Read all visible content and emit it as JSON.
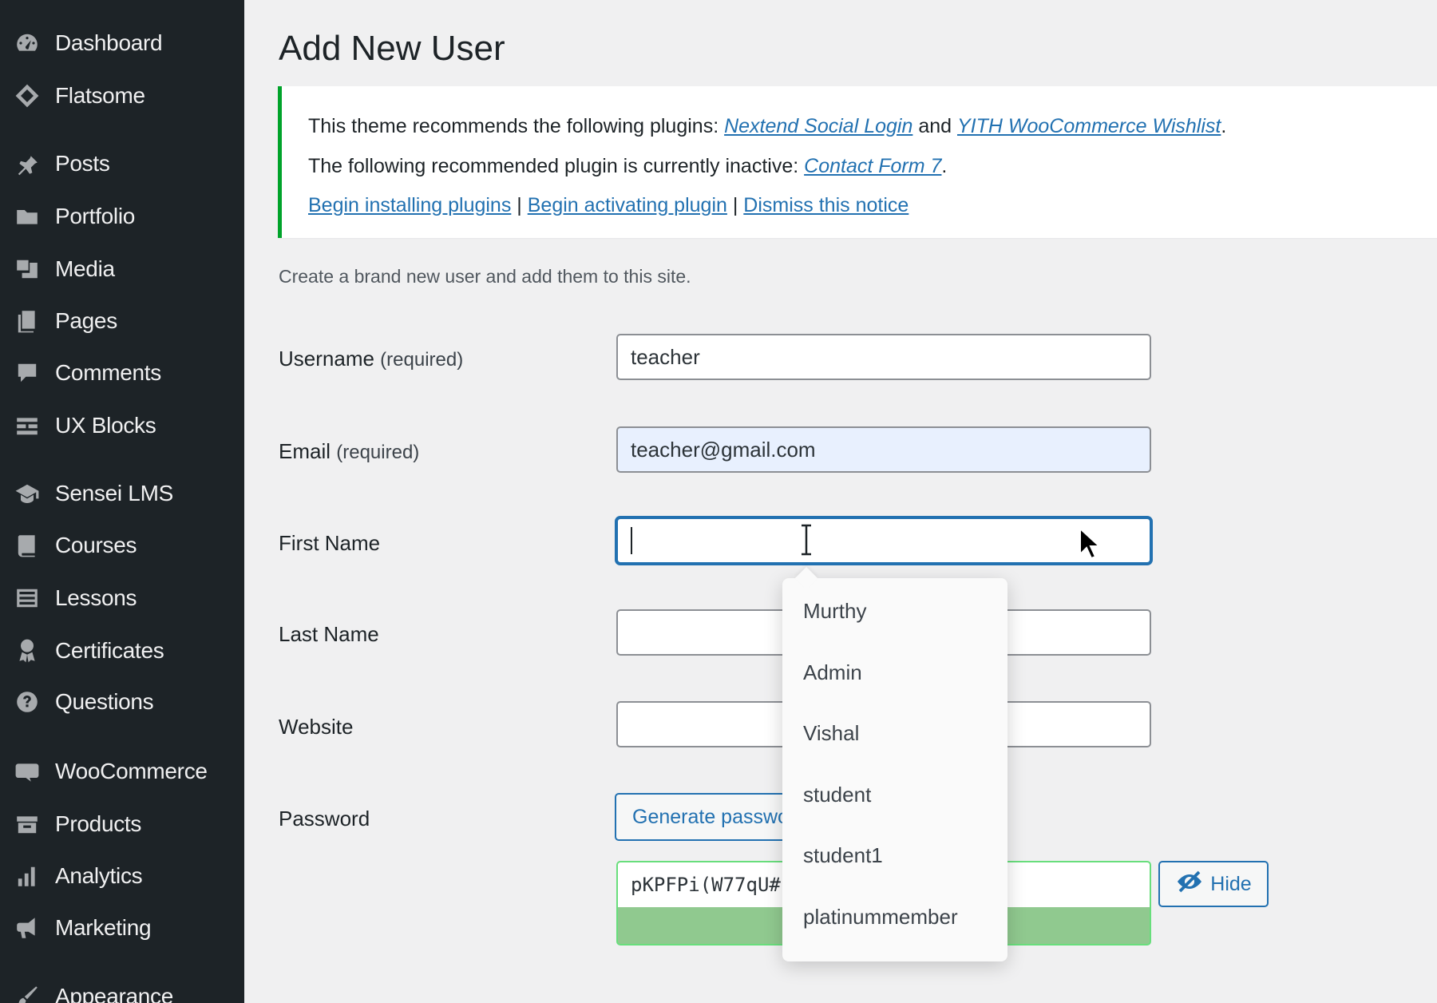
{
  "sidebar": {
    "items": [
      {
        "label": "Dashboard",
        "icon": "dashboard-icon"
      },
      {
        "label": "Flatsome",
        "icon": "flatsome-icon"
      },
      {
        "label": "Posts",
        "icon": "pin-icon"
      },
      {
        "label": "Portfolio",
        "icon": "folder-icon"
      },
      {
        "label": "Media",
        "icon": "media-icon"
      },
      {
        "label": "Pages",
        "icon": "pages-icon"
      },
      {
        "label": "Comments",
        "icon": "comment-icon"
      },
      {
        "label": "UX Blocks",
        "icon": "blocks-icon"
      },
      {
        "label": "Sensei LMS",
        "icon": "graduation-cap-icon"
      },
      {
        "label": "Courses",
        "icon": "book-icon"
      },
      {
        "label": "Lessons",
        "icon": "list-icon"
      },
      {
        "label": "Certificates",
        "icon": "award-icon"
      },
      {
        "label": "Questions",
        "icon": "help-icon"
      },
      {
        "label": "WooCommerce",
        "icon": "woo-icon"
      },
      {
        "label": "Products",
        "icon": "archive-icon"
      },
      {
        "label": "Analytics",
        "icon": "bar-chart-icon"
      },
      {
        "label": "Marketing",
        "icon": "megaphone-icon"
      },
      {
        "label": "Appearance",
        "icon": "brush-icon"
      }
    ]
  },
  "page": {
    "title": "Add New User",
    "intro": "Create a brand new user and add them to this site."
  },
  "notice": {
    "line1_prefix": "This theme recommends the following plugins: ",
    "plugin1": "Nextend Social Login",
    "and": " and ",
    "plugin2": "YITH WooCommerce Wishlist",
    "line1_suffix": ".",
    "line2_prefix": "The following recommended plugin is currently inactive: ",
    "plugin3": "Contact Form 7",
    "line2_suffix": ".",
    "link_install": "Begin installing plugins",
    "sep": " | ",
    "link_activate": "Begin activating plugin",
    "link_dismiss": "Dismiss this notice"
  },
  "form": {
    "username_label": "Username",
    "username_req": "(required)",
    "username_value": "teacher",
    "email_label": "Email",
    "email_req": "(required)",
    "email_value": "teacher@gmail.com",
    "first_name_label": "First Name",
    "last_name_label": "Last Name",
    "website_label": "Website",
    "password_label": "Password",
    "generate_label": "Generate passwo",
    "password_value": "pKPFPi(W77qU#",
    "hide_label": "Hide"
  },
  "autocomplete": {
    "options": [
      "Murthy",
      "Admin",
      "Vishal",
      "student",
      "student1",
      "platinummember"
    ]
  },
  "colors": {
    "sidebar_bg": "#1d2327",
    "accent": "#2271b1",
    "notice_border": "#00a32a",
    "strength_good": "#90c98f"
  }
}
